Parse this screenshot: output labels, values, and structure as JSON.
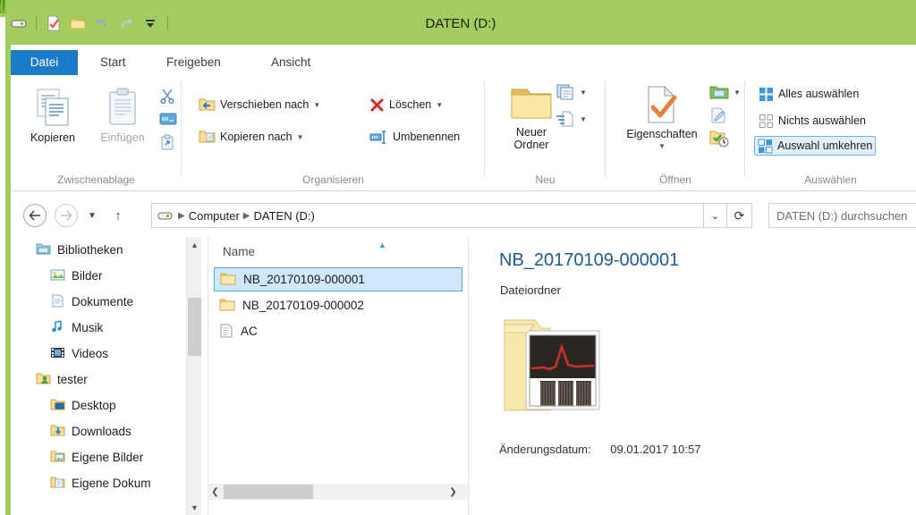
{
  "window": {
    "title": "DATEN (D:)"
  },
  "quick_access": {
    "items": [
      {
        "name": "drive-icon",
        "label": "DATEN (D:)"
      },
      {
        "name": "properties-icon",
        "label": "Eigenschaften"
      },
      {
        "name": "new-folder-icon",
        "label": "Neuer Ordner"
      },
      {
        "name": "undo-icon",
        "label": "Rückgängig"
      },
      {
        "name": "redo-icon",
        "label": "Wiederholen"
      },
      {
        "name": "customize-icon",
        "label": "Symbolleiste für den Schnellzugriff anpassen"
      }
    ]
  },
  "tabs": [
    {
      "label": "Datei",
      "state": "file"
    },
    {
      "label": "Start",
      "state": "active"
    },
    {
      "label": "Freigeben",
      "state": "normal"
    },
    {
      "label": "Ansicht",
      "state": "normal"
    }
  ],
  "ribbon": {
    "clipboard": {
      "group_label": "Zwischenablage",
      "copy": "Kopieren",
      "paste": "Einfügen",
      "cut_icon": "scissors-icon",
      "copy_path_icon": "copy-path-icon",
      "paste_shortcut_icon": "paste-shortcut-icon"
    },
    "organize": {
      "group_label": "Organisieren",
      "move_to": "Verschieben nach",
      "copy_to": "Kopieren nach",
      "delete": "Löschen",
      "rename": "Umbenennen"
    },
    "new": {
      "group_label": "Neu",
      "new_folder": "Neuer\nOrdner",
      "new_folder_line1": "Neuer",
      "new_folder_line2": "Ordner",
      "new_item_icon": "new-item-icon",
      "easy_access_icon": "easy-access-icon"
    },
    "open": {
      "group_label": "Öffnen",
      "properties": "Eigenschaften",
      "open_icon": "open-with-icon",
      "edit_icon": "edit-icon",
      "history_icon": "history-icon"
    },
    "select": {
      "group_label": "Auswählen",
      "select_all": "Alles auswählen",
      "select_none": "Nichts auswählen",
      "invert_selection": "Auswahl umkehren"
    }
  },
  "addressbar": {
    "back_icon": "back-arrow-icon",
    "forward_icon": "forward-arrow-icon",
    "recent_icon": "recent-locations-icon",
    "up_icon": "up-arrow-icon",
    "drive_icon": "drive-icon",
    "breadcrumbs": [
      "Computer",
      "DATEN (D:)"
    ],
    "dropdown_icon": "chevron-down-icon",
    "refresh_icon": "refresh-icon",
    "search_placeholder": "DATEN (D:) durchsuchen"
  },
  "sidebar": {
    "items": [
      {
        "label": "Bibliotheken",
        "icon": "libraries-icon",
        "indent": 0
      },
      {
        "label": "Bilder",
        "icon": "pictures-icon",
        "indent": 1
      },
      {
        "label": "Dokumente",
        "icon": "documents-icon",
        "indent": 1
      },
      {
        "label": "Musik",
        "icon": "music-icon",
        "indent": 1
      },
      {
        "label": "Videos",
        "icon": "videos-icon",
        "indent": 1
      },
      {
        "label": "tester",
        "icon": "user-folder-icon",
        "indent": 0
      },
      {
        "label": "Desktop",
        "icon": "desktop-folder-icon",
        "indent": 1
      },
      {
        "label": "Downloads",
        "icon": "downloads-folder-icon",
        "indent": 1
      },
      {
        "label": "Eigene Bilder",
        "icon": "my-pictures-icon",
        "indent": 1
      },
      {
        "label": "Eigene Dokum",
        "icon": "my-documents-icon",
        "indent": 1
      }
    ]
  },
  "filelist": {
    "column_header": "Name",
    "sort_arrow": "sort-ascending-icon",
    "rows": [
      {
        "name": "NB_20170109-000001",
        "icon": "folder-icon",
        "selected": true
      },
      {
        "name": "NB_20170109-000002",
        "icon": "folder-icon",
        "selected": false
      },
      {
        "name": "AC",
        "icon": "text-file-icon",
        "selected": false
      }
    ]
  },
  "details": {
    "title": "NB_20170109-000001",
    "type": "Dateiordner",
    "preview_icon": "folder-with-chart-thumbnail",
    "modified_label": "Änderungsdatum:",
    "modified_value": "09.01.2017 10:57"
  },
  "colors": {
    "wallpaper_green": "#a3cc5e",
    "file_tab_blue": "#1a7bc6",
    "selection_blue": "#cde8ff",
    "detail_title_blue": "#1f5a8f"
  }
}
